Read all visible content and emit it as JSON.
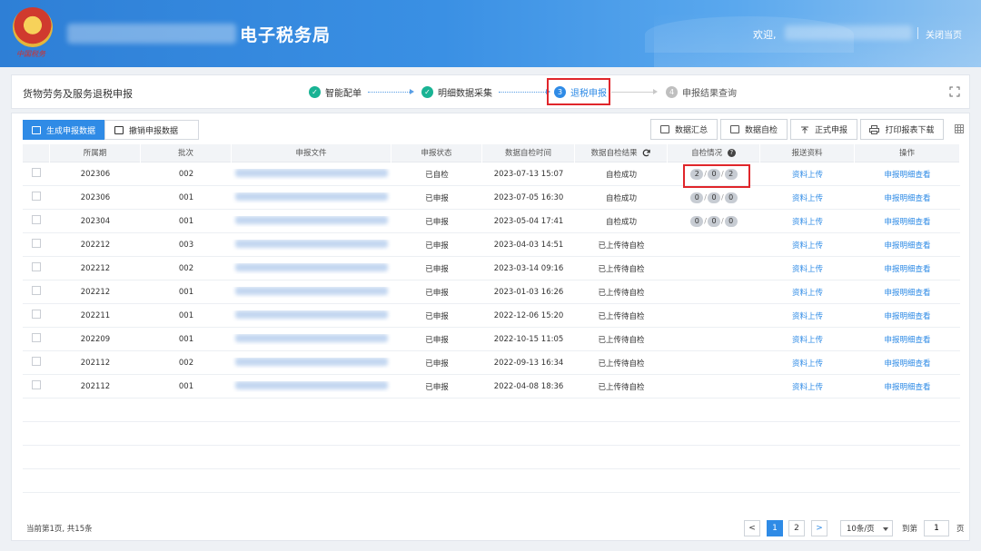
{
  "header": {
    "emblem_text": "中国税务",
    "system_title": "电子税务局",
    "welcome": "欢迎,",
    "close_page": "关闭当页"
  },
  "steps_bar": {
    "page_name": "货物劳务及服务退税申报",
    "steps": [
      {
        "num": "✓",
        "label": "智能配单",
        "state": "done"
      },
      {
        "num": "✓",
        "label": "明细数据采集",
        "state": "done"
      },
      {
        "num": "3",
        "label": "退税申报",
        "state": "current"
      },
      {
        "num": "4",
        "label": "申报结果查询",
        "state": "todo"
      }
    ]
  },
  "tabs": [
    {
      "label": "生成申报数据",
      "active": true
    },
    {
      "label": "撤销申报数据",
      "active": false
    }
  ],
  "toolbar": [
    {
      "label": "数据汇总"
    },
    {
      "label": "数据自检"
    },
    {
      "label": "正式申报"
    },
    {
      "label": "打印报表下载"
    }
  ],
  "table": {
    "headers": [
      "",
      "所属期",
      "批次",
      "申报文件",
      "申报状态",
      "数据自检时间",
      "数据自检结果",
      "自检情况",
      "报送资料",
      "操作"
    ],
    "rows": [
      {
        "period": "202306",
        "batch": "002",
        "status": "已自检",
        "time": "2023-07-13 15:07",
        "result": "自检成功",
        "counts": [
          "2",
          "0",
          "2"
        ],
        "upload": "资料上传",
        "op": "申报明细查看"
      },
      {
        "period": "202306",
        "batch": "001",
        "status": "已申报",
        "time": "2023-07-05 16:30",
        "result": "自检成功",
        "counts": [
          "0",
          "0",
          "0"
        ],
        "upload": "资料上传",
        "op": "申报明细查看"
      },
      {
        "period": "202304",
        "batch": "001",
        "status": "已申报",
        "time": "2023-05-04 17:41",
        "result": "自检成功",
        "counts": [
          "0",
          "0",
          "0"
        ],
        "upload": "资料上传",
        "op": "申报明细查看"
      },
      {
        "period": "202212",
        "batch": "003",
        "status": "已申报",
        "time": "2023-04-03 14:51",
        "result": "已上传待自检",
        "counts": [],
        "upload": "资料上传",
        "op": "申报明细查看"
      },
      {
        "period": "202212",
        "batch": "002",
        "status": "已申报",
        "time": "2023-03-14 09:16",
        "result": "已上传待自检",
        "counts": [],
        "upload": "资料上传",
        "op": "申报明细查看"
      },
      {
        "period": "202212",
        "batch": "001",
        "status": "已申报",
        "time": "2023-01-03 16:26",
        "result": "已上传待自检",
        "counts": [],
        "upload": "资料上传",
        "op": "申报明细查看"
      },
      {
        "period": "202211",
        "batch": "001",
        "status": "已申报",
        "time": "2022-12-06 15:20",
        "result": "已上传待自检",
        "counts": [],
        "upload": "资料上传",
        "op": "申报明细查看"
      },
      {
        "period": "202209",
        "batch": "001",
        "status": "已申报",
        "time": "2022-10-15 11:05",
        "result": "已上传待自检",
        "counts": [],
        "upload": "资料上传",
        "op": "申报明细查看"
      },
      {
        "period": "202112",
        "batch": "002",
        "status": "已申报",
        "time": "2022-09-13 16:34",
        "result": "已上传待自检",
        "counts": [],
        "upload": "资料上传",
        "op": "申报明细查看"
      },
      {
        "period": "202112",
        "batch": "001",
        "status": "已申报",
        "time": "2022-04-08 18:36",
        "result": "已上传待自检",
        "counts": [],
        "upload": "资料上传",
        "op": "申报明细查看"
      }
    ]
  },
  "footer": {
    "summary": "当前第1页, 共15条",
    "pages": [
      "1",
      "2"
    ],
    "prev": "<",
    "next": ">",
    "page_size": "10条/页",
    "goto_label": "到第",
    "goto_value": "1",
    "goto_suffix": "页"
  },
  "colors": {
    "primary": "#2f8be6",
    "done": "#19b394",
    "highlight": "#e0262b"
  }
}
